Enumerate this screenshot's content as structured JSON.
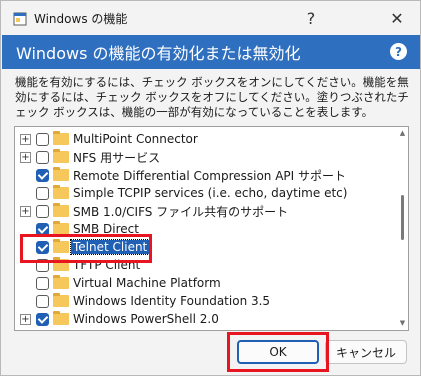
{
  "window": {
    "title": "Windows の機能",
    "help_label": "?",
    "close_label": "✕"
  },
  "header": {
    "title": "Windows の機能の有効化または無効化",
    "help_label": "?"
  },
  "description": "機能を有効にするには、チェック ボックスをオンにしてください。機能を無効にするには、チェック ボックスをオフにしてください。塗りつぶされたチェック ボックスは、機能の一部が有効になっていることを表します。",
  "features": [
    {
      "label": "MultiPoint Connector",
      "expandable": true,
      "checked": false
    },
    {
      "label": "NFS 用サービス",
      "expandable": true,
      "checked": false
    },
    {
      "label": "Remote Differential Compression API サポート",
      "expandable": false,
      "checked": true
    },
    {
      "label": "Simple TCPIP services (i.e. echo, daytime etc)",
      "expandable": false,
      "checked": false
    },
    {
      "label": "SMB 1.0/CIFS ファイル共有のサポート",
      "expandable": true,
      "checked": false
    },
    {
      "label": "SMB Direct",
      "expandable": false,
      "checked": true
    },
    {
      "label": "Telnet Client",
      "expandable": false,
      "checked": true,
      "selected": true
    },
    {
      "label": "TFTP Client",
      "expandable": false,
      "checked": false
    },
    {
      "label": "Virtual Machine Platform",
      "expandable": false,
      "checked": false
    },
    {
      "label": "Windows Identity Foundation 3.5",
      "expandable": false,
      "checked": false
    },
    {
      "label": "Windows PowerShell 2.0",
      "expandable": true,
      "checked": true
    }
  ],
  "buttons": {
    "ok": "OK",
    "cancel": "キャンセル"
  },
  "colors": {
    "header_blue": "#2f6fbf",
    "check_blue": "#1f5fb4",
    "highlight_red": "#e8141f"
  }
}
